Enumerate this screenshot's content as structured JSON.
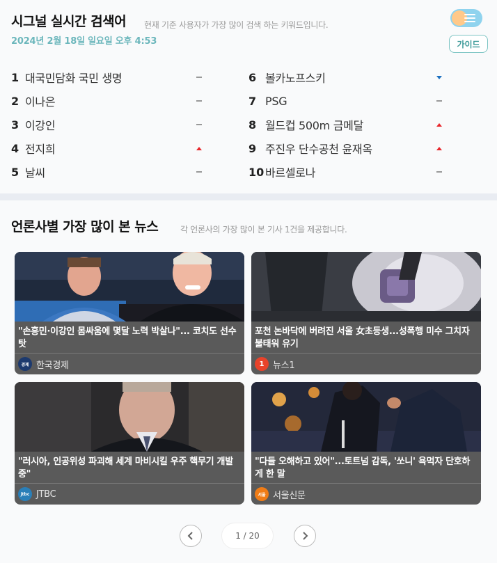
{
  "realtime": {
    "title": "시그널 실시간 검색어",
    "description": "현재 기준 사용자가 가장 많이 검색 하는 키워드입니다.",
    "date": "2024년 2월 18일 일요일 오후 4:53",
    "guide_label": "가이드",
    "keywords": [
      {
        "rank": "1",
        "term": "대국민담화 국민 생명",
        "trend": "same"
      },
      {
        "rank": "2",
        "term": "이나은",
        "trend": "same"
      },
      {
        "rank": "3",
        "term": "이강인",
        "trend": "same"
      },
      {
        "rank": "4",
        "term": "전지희",
        "trend": "up"
      },
      {
        "rank": "5",
        "term": "날씨",
        "trend": "same"
      },
      {
        "rank": "6",
        "term": "볼카노프스키",
        "trend": "down"
      },
      {
        "rank": "7",
        "term": "PSG",
        "trend": "same"
      },
      {
        "rank": "8",
        "term": "월드컵 500m 금메달",
        "trend": "up"
      },
      {
        "rank": "9",
        "term": "주진우 단수공천 윤재옥",
        "trend": "up"
      },
      {
        "rank": "10",
        "term": "바르셀로나",
        "trend": "same"
      }
    ]
  },
  "news": {
    "title": "언론사별 가장 많이 본 뉴스",
    "description": "각 언론사의 가장 많이 본 기사 1건을 제공합니다.",
    "cards": [
      {
        "headline": "\"손흥민·이강인 몸싸움에 몇달 노력 박살나\"... 코치도 선수 탓",
        "source": "한국경제",
        "logo_text": "한국\n경제",
        "logo_color": "#1d3a6e"
      },
      {
        "headline": "포천 논바닥에 버려진 서울 女초등생...성폭행 미수 그치자 불태워 유기",
        "source": "뉴스1",
        "logo_text": "1",
        "logo_color": "#e8432b"
      },
      {
        "headline": "\"러시아, 인공위성 파괴해 세계 마비시킬 우주 핵무기 개발 중\"",
        "source": "JTBC",
        "logo_text": "jtbc",
        "logo_color": "#2a7fb8"
      },
      {
        "headline": "\"다들 오해하고 있어\"...토트넘 감독, '쏘니' 욕먹자 단호하게 한 말",
        "source": "서울신문",
        "logo_text": "서울",
        "logo_color": "#f07c16"
      }
    ],
    "pager": {
      "text": "1 / 20"
    }
  }
}
